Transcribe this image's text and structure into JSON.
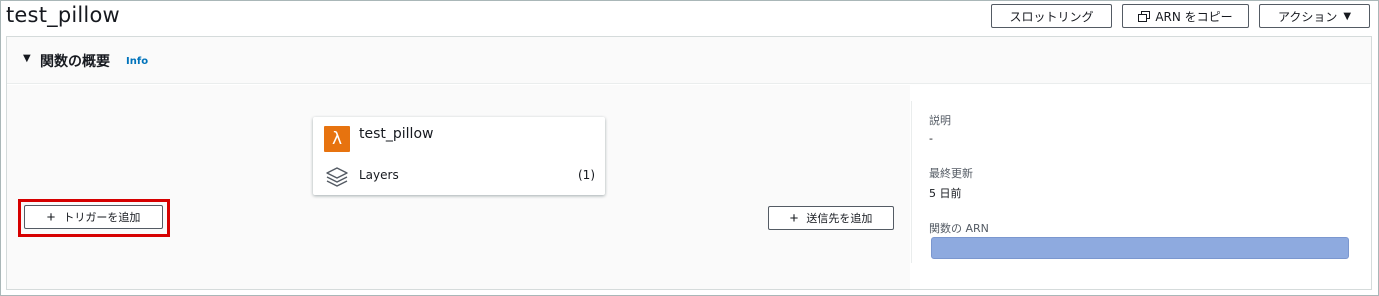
{
  "header": {
    "function_name": "test_pillow",
    "buttons": {
      "throttle": "スロットリング",
      "copy_arn": "ARN をコピー",
      "actions": "アクション"
    },
    "icons": {
      "copy": "copy-icon",
      "actions_caret": "caret-down-icon"
    }
  },
  "overview": {
    "caret": "▼",
    "title": "関数の概要",
    "info": "Info"
  },
  "diagram": {
    "function_card": {
      "name": "test_pillow",
      "icon": "lambda-icon",
      "layers_label": "Layers",
      "layers_count": "(1)"
    },
    "add_trigger": "トリガーを追加",
    "add_destination": "送信先を追加",
    "highlight_color": "#d60000"
  },
  "details": {
    "description_label": "説明",
    "description_value": "-",
    "last_modified_label": "最終更新",
    "last_modified_value": "5 日前",
    "arn_label": "関数の ARN"
  },
  "colors": {
    "lambda_orange": "#e7730f",
    "link_blue": "#0073bb",
    "arn_redacted": "#8eaadf"
  }
}
